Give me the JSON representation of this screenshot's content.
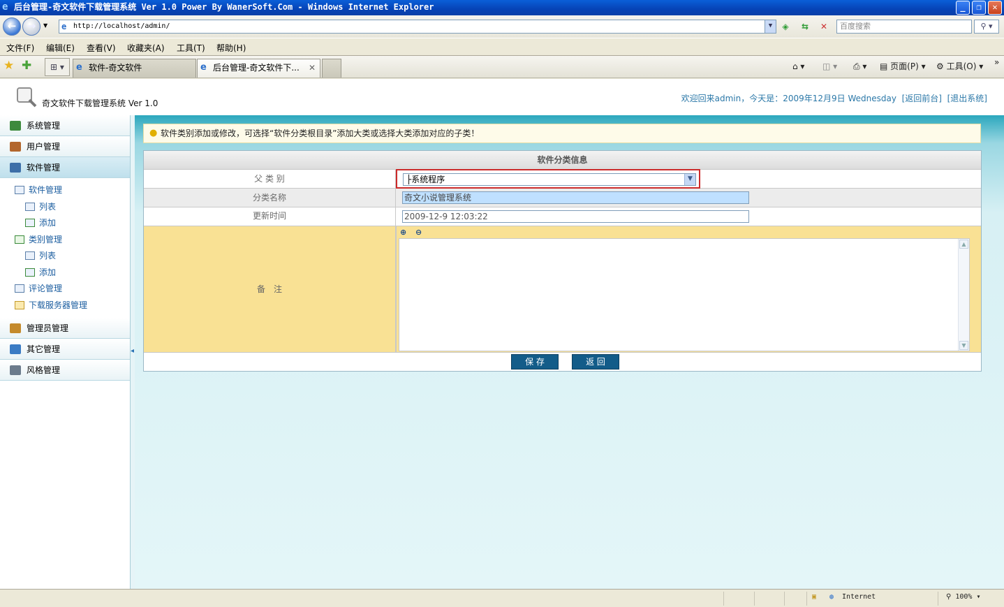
{
  "window": {
    "title": "后台管理-奇文软件下载管理系统 Ver 1.0 Power By WanerSoft.Com - Windows Internet Explorer"
  },
  "browser": {
    "address": "http://localhost/admin/",
    "search_placeholder": "百度搜索",
    "menu": [
      "文件(F)",
      "编辑(E)",
      "查看(V)",
      "收藏夹(A)",
      "工具(T)",
      "帮助(H)"
    ],
    "tabs": [
      {
        "label": "软件-奇文软件",
        "active": false
      },
      {
        "label": "后台管理-奇文软件下...",
        "active": true
      }
    ],
    "tools": {
      "page": "页面(P)",
      "tools": "工具(O)"
    },
    "status": {
      "zone": "Internet",
      "zoom": "100%"
    }
  },
  "header": {
    "system_name": "奇文软件下载管理系统",
    "version": "Ver 1.0",
    "welcome_prefix": "欢迎回来",
    "user": "admin",
    "today_label": "，今天是：",
    "date": "2009年12月9日 Wednesday",
    "back_link": "[返回前台]",
    "logout_link": "[退出系统]"
  },
  "sidebar": {
    "sections": [
      {
        "label": "系统管理",
        "icon": "system-icon",
        "color": "#3d8a3d"
      },
      {
        "label": "用户管理",
        "icon": "users-icon",
        "color": "#b2662c"
      },
      {
        "label": "软件管理",
        "icon": "table-icon",
        "color": "#3d6fa8",
        "active": true
      }
    ],
    "software_sub": [
      {
        "label": "软件管理",
        "level": 1
      },
      {
        "label": "列表",
        "level": 2
      },
      {
        "label": "添加",
        "level": 2
      },
      {
        "label": "类别管理",
        "level": 1
      },
      {
        "label": "列表",
        "level": 2
      },
      {
        "label": "添加",
        "level": 2
      },
      {
        "label": "评论管理",
        "level": 1
      },
      {
        "label": "下载服务器管理",
        "level": 1
      }
    ],
    "sections_after": [
      {
        "label": "管理员管理",
        "icon": "admin-icon",
        "color": "#c48a2c"
      },
      {
        "label": "其它管理",
        "icon": "monitor-icon",
        "color": "#3a7bc4"
      },
      {
        "label": "风格管理",
        "icon": "style-icon",
        "color": "#6b7b8c"
      }
    ]
  },
  "main": {
    "tip": "软件类别添加或修改，可选择“软件分类根目录”添加大类或选择大类添加对应的子类！",
    "form_title": "软件分类信息",
    "fields": {
      "parent_label": "父 类 别",
      "parent_value": "├系统程序",
      "name_label": "分类名称",
      "name_value": "奇文小说管理系统",
      "time_label": "更新时间",
      "time_value": "2009-12-9 12:03:22",
      "note_label": "备　注",
      "note_value": ""
    },
    "buttons": {
      "save": "保 存",
      "back": "返 回"
    }
  }
}
